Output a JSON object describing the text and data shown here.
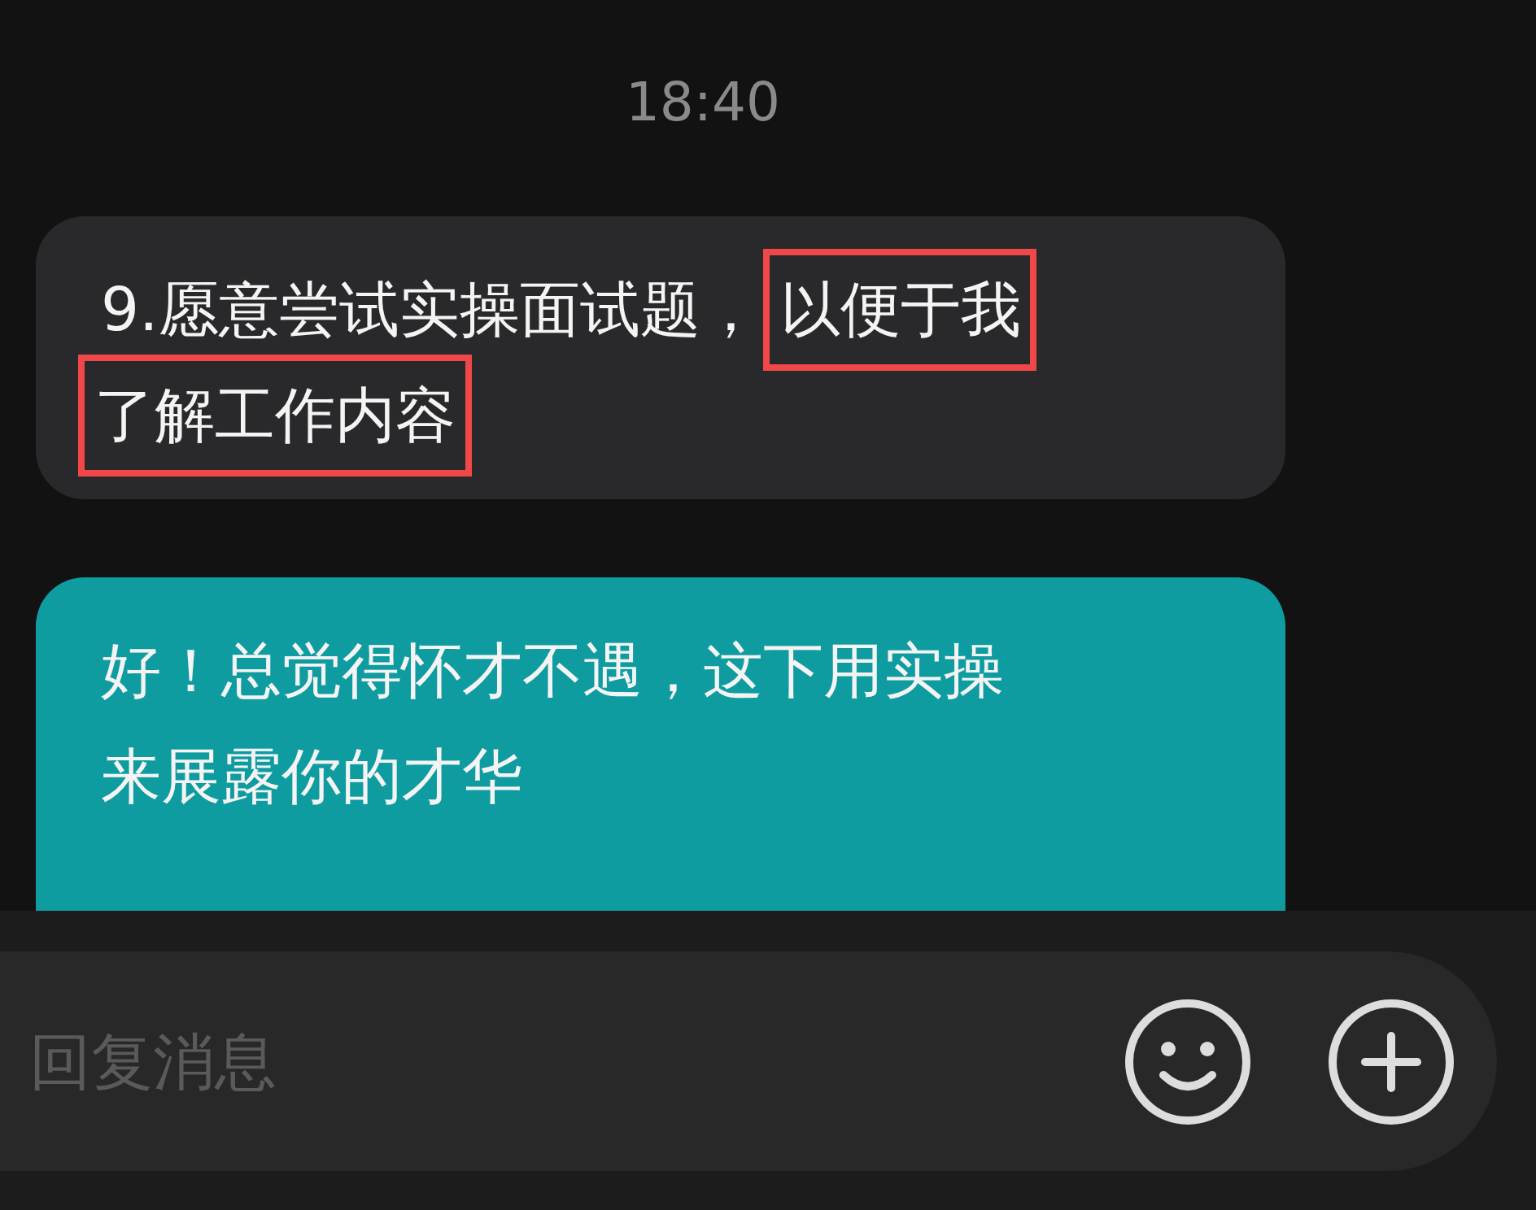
{
  "timestamp": "18:40",
  "messages": [
    {
      "kind": "received",
      "lines": [
        [
          {
            "text": "9.愿意尝试实操面试题，",
            "highlighted": false
          },
          {
            "text": "以便于我",
            "highlighted": true
          }
        ],
        [
          {
            "text": "了解工作内容",
            "highlighted": true
          }
        ]
      ]
    },
    {
      "kind": "sent",
      "lines": [
        [
          {
            "text": "好！总觉得怀才不遇，这下用实操",
            "highlighted": false
          }
        ],
        [
          {
            "text": "来展露你的才华",
            "highlighted": false
          }
        ]
      ]
    }
  ],
  "input": {
    "placeholder": "回复消息"
  }
}
